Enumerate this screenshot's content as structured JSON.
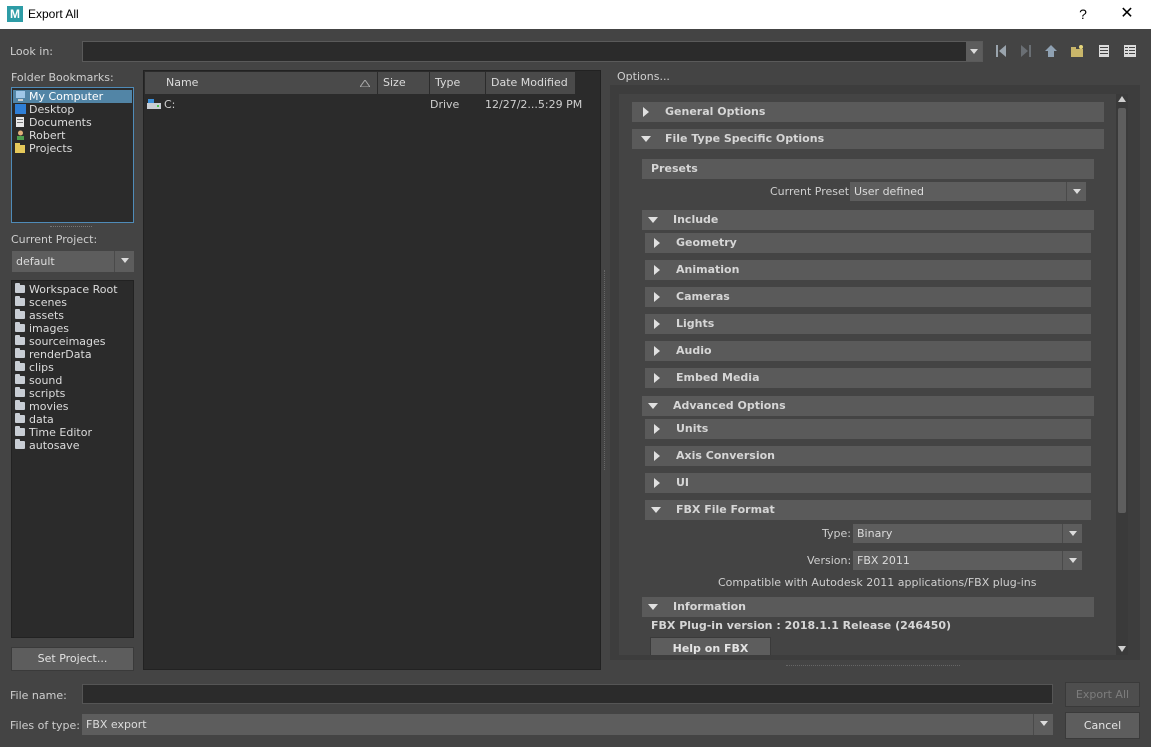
{
  "window": {
    "title": "Export All",
    "help": "?",
    "close": "✕",
    "logo": "M"
  },
  "lookin": {
    "label": "Look in:",
    "value": ""
  },
  "bookmarks": {
    "label": "Folder Bookmarks:",
    "items": [
      {
        "label": "My Computer",
        "icon": "computer-icon",
        "selected": true
      },
      {
        "label": "Desktop",
        "icon": "desktop-icon"
      },
      {
        "label": "Documents",
        "icon": "documents-icon"
      },
      {
        "label": "Robert",
        "icon": "user-icon"
      },
      {
        "label": "Projects",
        "icon": "projects-icon"
      }
    ]
  },
  "project": {
    "label": "Current Project:",
    "value": "default",
    "folders": [
      "Workspace Root",
      "scenes",
      "assets",
      "images",
      "sourceimages",
      "renderData",
      "clips",
      "sound",
      "scripts",
      "movies",
      "data",
      "Time Editor",
      "autosave"
    ],
    "set_button": "Set Project..."
  },
  "fileview": {
    "columns": [
      "Name",
      "Size",
      "Type",
      "Date Modified"
    ],
    "rows": [
      {
        "name": "C:",
        "size": "",
        "type": "Drive",
        "date": "12/27/2...5:29 PM"
      }
    ]
  },
  "options": {
    "label": "Options...",
    "general": "General Options",
    "filetype": "File Type Specific Options",
    "presets": "Presets",
    "current_preset_label": "Current Preset:",
    "current_preset_value": "User defined",
    "include": "Include",
    "include_items": [
      "Geometry",
      "Animation",
      "Cameras",
      "Lights",
      "Audio",
      "Embed Media"
    ],
    "advanced": "Advanced Options",
    "advanced_items": [
      "Units",
      "Axis Conversion",
      "UI"
    ],
    "fbx_format": "FBX File Format",
    "type_label": "Type:",
    "type_value": "Binary",
    "version_label": "Version:",
    "version_value": "FBX 2011",
    "compat": "Compatible with Autodesk 2011 applications/FBX plug-ins",
    "information": "Information",
    "plugin_version": "FBX Plug-in version :  2018.1.1 Release (246450)",
    "help_button": "Help on FBX"
  },
  "footer": {
    "filename_label": "File name:",
    "filename_value": "",
    "filetype_label": "Files of type:",
    "filetype_value": "FBX export",
    "export_button": "Export All",
    "cancel_button": "Cancel"
  }
}
